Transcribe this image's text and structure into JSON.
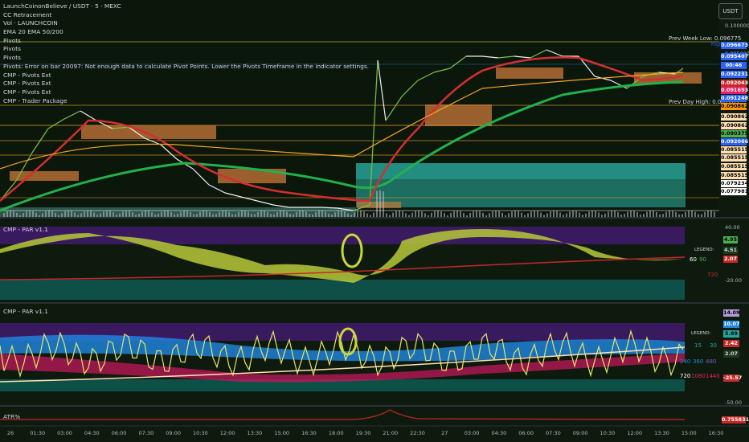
{
  "header": {
    "title": "LaunchCoinonBelieve / USDT · 5 · MEXC",
    "currency_button": "USDT"
  },
  "overlays": [
    "CC Retracement",
    "Vol · LAUNCHCOIN",
    "EMA 20 EMA 50/200",
    "Pivots",
    "Pivots",
    "Pivots",
    "Pivots: Error on bar 20097: Not enough data to calculate Pivot Points. Lower the Pivots Timeframe in the indicator settings.",
    "CMP - Pivots Ext",
    "CMP - Pivots Ext",
    "CMP - Pivots Ext",
    "CMP - Trader Package"
  ],
  "price_axis": {
    "top_value": "0.100000",
    "mid_value": "0.095000",
    "tags": [
      {
        "label": "High",
        "value": "0.096673",
        "bg": "#2962ff",
        "fg": "#ffffff"
      },
      {
        "label": "",
        "value": "0.095407",
        "bg": "#2962ff",
        "fg": "#ffffff"
      },
      {
        "label": "",
        "value": "00:46",
        "bg": "#2962ff",
        "fg": "#ffffff"
      },
      {
        "label": "",
        "value": "0.092231",
        "bg": "#2962ff",
        "fg": "#ffffff"
      },
      {
        "label": "",
        "value": "0.092043",
        "bg": "#c62828",
        "fg": "#ffffff"
      },
      {
        "label": "",
        "value": "0.091693",
        "bg": "#e91e63",
        "fg": "#ffffff"
      },
      {
        "label": "",
        "value": "0.091248",
        "bg": "#2962ff",
        "fg": "#ffffff"
      },
      {
        "label": "",
        "value": "0.090862",
        "bg": "#ff9800",
        "fg": "#000000"
      },
      {
        "label": "",
        "value": "0.090862",
        "bg": "#ffe0b2",
        "fg": "#000000"
      },
      {
        "label": "",
        "value": "0.090862",
        "bg": "#ffe0b2",
        "fg": "#000000"
      },
      {
        "label": "",
        "value": "0.090375",
        "bg": "#4caf50",
        "fg": "#000000"
      },
      {
        "label": "",
        "value": "0.092066",
        "bg": "#2962ff",
        "fg": "#ffffff"
      },
      {
        "label": "",
        "value": "0.085515",
        "bg": "#ffe0b2",
        "fg": "#000000"
      },
      {
        "label": "",
        "value": "0.085515",
        "bg": "#ffe0b2",
        "fg": "#000000"
      },
      {
        "label": "",
        "value": "0.085515",
        "bg": "#ffe0b2",
        "fg": "#000000"
      },
      {
        "label": "",
        "value": "0.085515",
        "bg": "#ffe0b2",
        "fg": "#000000"
      },
      {
        "label": "",
        "value": "0.079234",
        "bg": "#ffffff",
        "fg": "#000000"
      },
      {
        "label": "",
        "value": "0.077981",
        "bg": "#ffffff",
        "fg": "#000000"
      }
    ]
  },
  "annotations": {
    "prev_week_low": "Prev Week Low: 0.096775",
    "prev_day_high": "Prev Day High: 0.087263"
  },
  "pane1": {
    "label": "CMP - PAR v1.1",
    "axis": [
      "40.00",
      "-20.00"
    ],
    "legend_title": "LEGEND:",
    "legend_a": "60",
    "legend_b": "90",
    "legend_c": "720",
    "tags": [
      {
        "value": "4.95",
        "bg": "#4caf50",
        "fg": "#000000"
      },
      {
        "value": "4.51",
        "bg": "#1b3a1b",
        "fg": "#d1d4dc"
      },
      {
        "value": "2.07",
        "bg": "#c62828",
        "fg": "#ffffff"
      }
    ]
  },
  "pane2": {
    "label": "CMP - PAR v1.1",
    "axis": [
      "-50.00"
    ],
    "legend_title": "LEGEND:",
    "legend_a": "15",
    "legend_b": "30",
    "legend_c": "240",
    "legend_d": "360",
    "legend_e": "480",
    "legend_f": "720",
    "legend_g": "1080",
    "legend_h": "1440",
    "tags": [
      {
        "value": "14.09",
        "bg": "#b39ddb",
        "fg": "#000000"
      },
      {
        "value": "10.07",
        "bg": "#1e88e5",
        "fg": "#ffffff"
      },
      {
        "value": "5.89",
        "bg": "#26a69a",
        "fg": "#000000"
      },
      {
        "value": "2.42",
        "bg": "#c62828",
        "fg": "#ffffff"
      },
      {
        "value": "2.07",
        "bg": "#1b3a1b",
        "fg": "#d1d4dc"
      },
      {
        "value": "-25.57",
        "bg": "#c62828",
        "fg": "#ffffff"
      }
    ]
  },
  "pane3": {
    "label": "ATR%",
    "tag": {
      "value": "0.755831",
      "bg": "#c62828",
      "fg": "#ffffff"
    }
  },
  "time_axis": [
    "26",
    "01:30",
    "03:00",
    "04:30",
    "06:00",
    "07:30",
    "09:00",
    "10:30",
    "12:00",
    "13:30",
    "15:00",
    "16:30",
    "18:00",
    "19:30",
    "21:00",
    "22:30",
    "27",
    "03:00",
    "04:30",
    "06:00",
    "07:30",
    "09:00",
    "10:30",
    "12:00",
    "13:30",
    "15:00",
    "16:30"
  ],
  "colors": {
    "background": "#0f1a0e",
    "ema_green": "#22b14c",
    "ema_red": "#d32f2f",
    "orange_line": "#f5a623",
    "teal_zone": "#2bb5a8",
    "purple_zone": "#3a1a5e"
  }
}
